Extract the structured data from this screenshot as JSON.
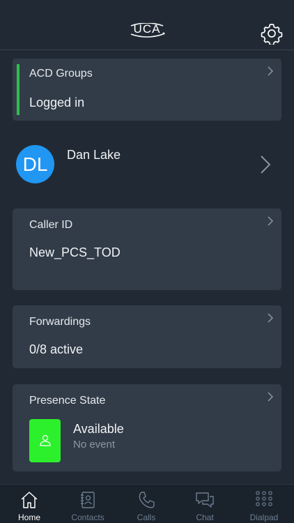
{
  "header": {
    "logo_text": "UCA",
    "logo_icon": "uca-logo",
    "settings_icon": "gear-icon"
  },
  "acd": {
    "title": "ACD Groups",
    "status": "Logged in",
    "status_color": "#2ebd4e"
  },
  "profile": {
    "initials": "DL",
    "name": "Dan Lake",
    "avatar_color": "#2196f3"
  },
  "caller_id": {
    "title": "Caller ID",
    "value": "New_PCS_TOD"
  },
  "forwardings": {
    "title": "Forwardings",
    "value": "0/8 active"
  },
  "presence": {
    "title": "Presence State",
    "state": "Available",
    "event": "No event",
    "state_color": "#2cf02c"
  },
  "tabs": [
    {
      "label": "Home",
      "icon": "home-icon",
      "active": true
    },
    {
      "label": "Contacts",
      "icon": "contacts-icon",
      "active": false
    },
    {
      "label": "Calls",
      "icon": "phone-icon",
      "active": false
    },
    {
      "label": "Chat",
      "icon": "chat-icon",
      "active": false
    },
    {
      "label": "Dialpad",
      "icon": "dialpad-icon",
      "active": false
    }
  ]
}
